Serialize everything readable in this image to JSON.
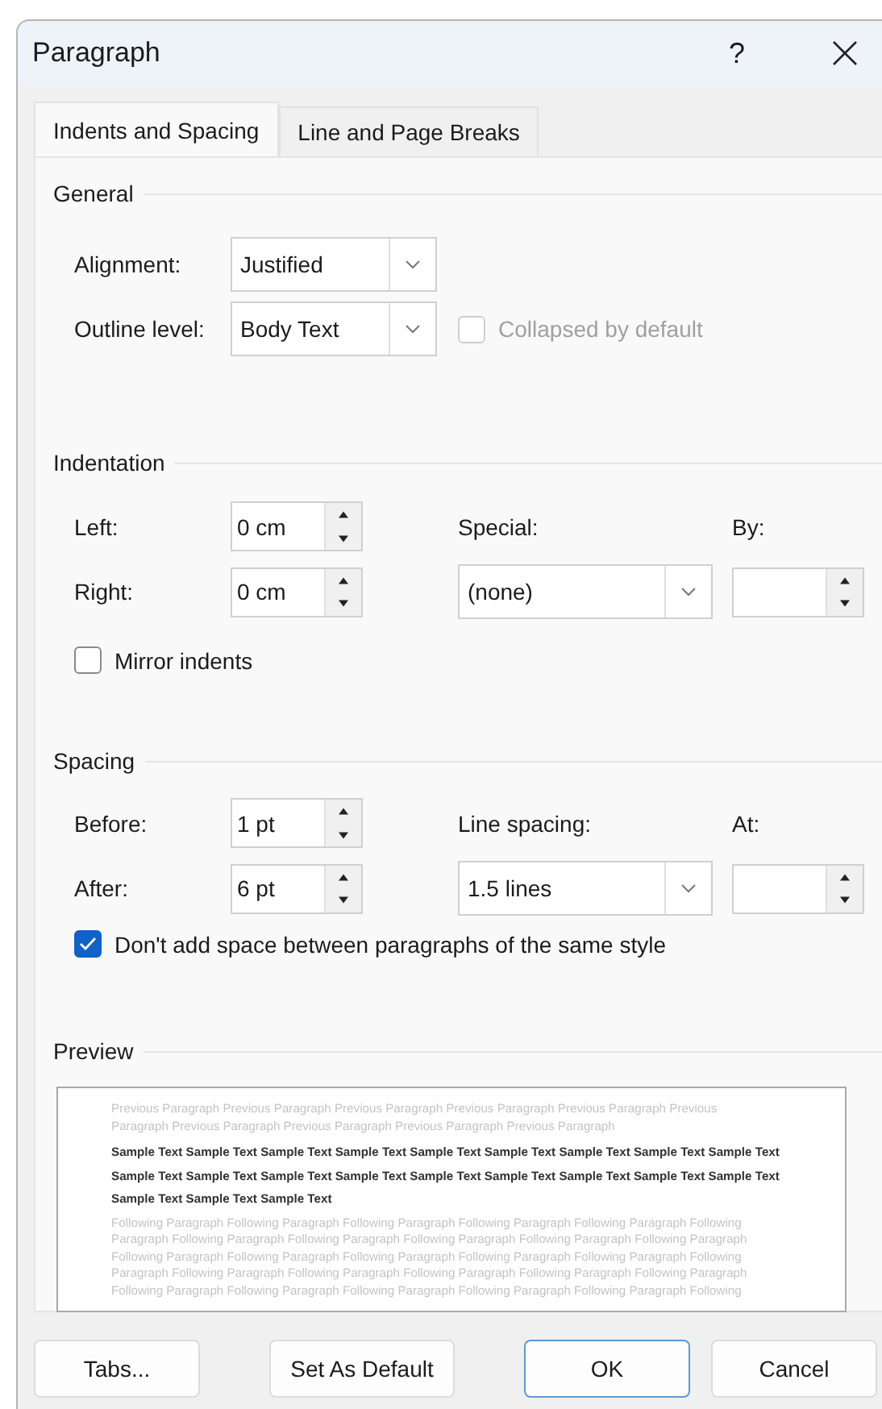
{
  "window": {
    "title": "Paragraph",
    "help": "?"
  },
  "tabs": [
    {
      "label": "Indents and Spacing",
      "selected": true
    },
    {
      "label": "Line and Page Breaks",
      "selected": false
    }
  ],
  "general": {
    "heading": "General",
    "alignment": {
      "label": "Alignment:",
      "value": "Justified"
    },
    "outline_level": {
      "label": "Outline level:",
      "value": "Body Text"
    },
    "collapsed": {
      "label": "Collapsed by default",
      "checked": false,
      "disabled": true
    }
  },
  "indentation": {
    "heading": "Indentation",
    "left": {
      "label": "Left:",
      "value": "0 cm"
    },
    "right": {
      "label": "Right:",
      "value": "0 cm"
    },
    "special": {
      "label": "Special:",
      "value": "(none)"
    },
    "by": {
      "label": "By:"
    },
    "mirror": {
      "label": "Mirror indents",
      "checked": false,
      "disabled": false
    }
  },
  "spacing": {
    "heading": "Spacing",
    "before": {
      "label": "Before:",
      "value": "1 pt"
    },
    "after": {
      "label": "After:",
      "value": "6 pt"
    },
    "line_spacing": {
      "label": "Line spacing:",
      "value": "1.5 lines"
    },
    "at": {
      "label": "At:"
    },
    "no_space": {
      "label": "Don't add space between paragraphs of the same style",
      "checked": true,
      "disabled": false
    }
  },
  "preview": {
    "heading": "Preview",
    "previous_lines": [
      "Previous Paragraph Previous Paragraph Previous Paragraph Previous Paragraph Previous Paragraph Previous",
      "Paragraph Previous Paragraph Previous Paragraph Previous Paragraph Previous Paragraph"
    ],
    "sample_lines": [
      "Sample Text Sample Text Sample Text Sample Text Sample Text Sample Text Sample Text Sample Text Sample Text",
      "Sample Text Sample Text Sample Text Sample Text Sample Text Sample Text Sample Text Sample Text Sample Text",
      "Sample Text Sample Text Sample Text"
    ],
    "following_lines": [
      "Following Paragraph Following Paragraph Following Paragraph Following Paragraph Following Paragraph Following",
      "Paragraph Following Paragraph Following Paragraph Following Paragraph Following Paragraph Following Paragraph",
      "Following Paragraph Following Paragraph Following Paragraph Following Paragraph Following Paragraph Following",
      "Paragraph Following Paragraph Following Paragraph Following Paragraph Following Paragraph Following Paragraph",
      "Following Paragraph Following Paragraph Following Paragraph Following Paragraph Following Paragraph Following"
    ]
  },
  "buttons": [
    {
      "label": "Tabs...",
      "default": false
    },
    {
      "label": "Set As Default",
      "default": false
    },
    {
      "label": "OK",
      "default": true
    },
    {
      "label": "Cancel",
      "default": false
    }
  ]
}
